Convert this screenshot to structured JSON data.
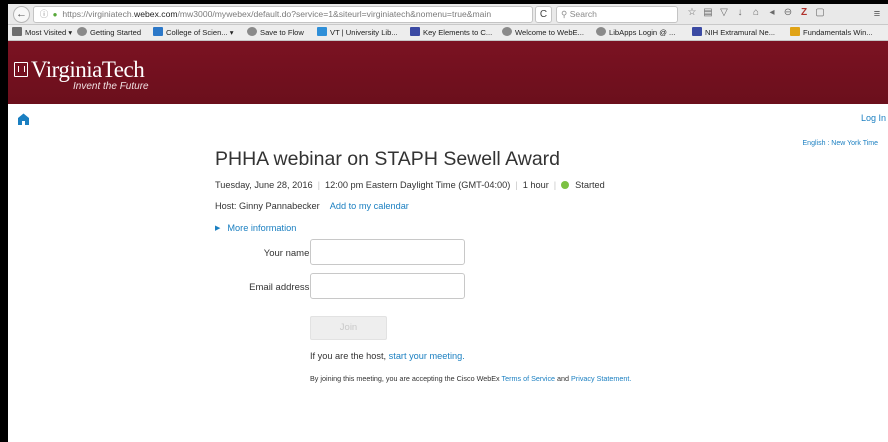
{
  "browser": {
    "url_prefix": "https://virginiatech.",
    "url_host": "webex.com",
    "url_rest": "/mw3000/mywebex/default.do?service=1&siteurl=virginiatech&nomenu=true&main",
    "search_placeholder": "Search",
    "bookmarks": [
      {
        "label": "Most Visited ▾",
        "color": "#6d6d6d"
      },
      {
        "label": "Getting Started",
        "color": "#8a8a8a"
      },
      {
        "label": "College of Scien... ▾",
        "color": "#2c78c8"
      },
      {
        "label": "Save to Flow",
        "color": "#8a8a8a"
      },
      {
        "label": "VT | University Lib...",
        "color": "#2f8fd8"
      },
      {
        "label": "Key Elements to C...",
        "color": "#3b4aa3"
      },
      {
        "label": "Welcome to WebE...",
        "color": "#8a8a8a"
      },
      {
        "label": "LibApps Login @ ...",
        "color": "#8a8a8a"
      },
      {
        "label": "NIH Extramural Ne...",
        "color": "#3b4aa3"
      },
      {
        "label": "Fundamentals Win...",
        "color": "#e0a316"
      }
    ]
  },
  "banner": {
    "brand_name": "VirginiaTech",
    "tagline": "Invent the Future"
  },
  "header": {
    "login_label": "Log In",
    "language_label": "English : New York Time"
  },
  "meeting": {
    "title": "PHHA webinar on STAPH Sewell Award",
    "date": "Tuesday, June 28, 2016",
    "time": "12:00 pm Eastern Daylight Time (GMT-04:00)",
    "duration": "1 hour",
    "status": "Started",
    "status_color": "#7cc142",
    "host_text": "Host: Ginny Pannabecker",
    "calendar_link": "Add to my calendar",
    "more_info": "More information"
  },
  "form": {
    "name_label": "Your name:",
    "name_value": "",
    "email_label": "Email address:",
    "email_value": "",
    "join_label": "Join"
  },
  "footer": {
    "host_prefix": "If you are the host,",
    "host_link": "start your meeting.",
    "terms_prefix": "By joining this meeting, you are accepting the Cisco WebEx",
    "terms_link": "Terms of Service",
    "terms_and": "and",
    "privacy_link": "Privacy Statement."
  }
}
